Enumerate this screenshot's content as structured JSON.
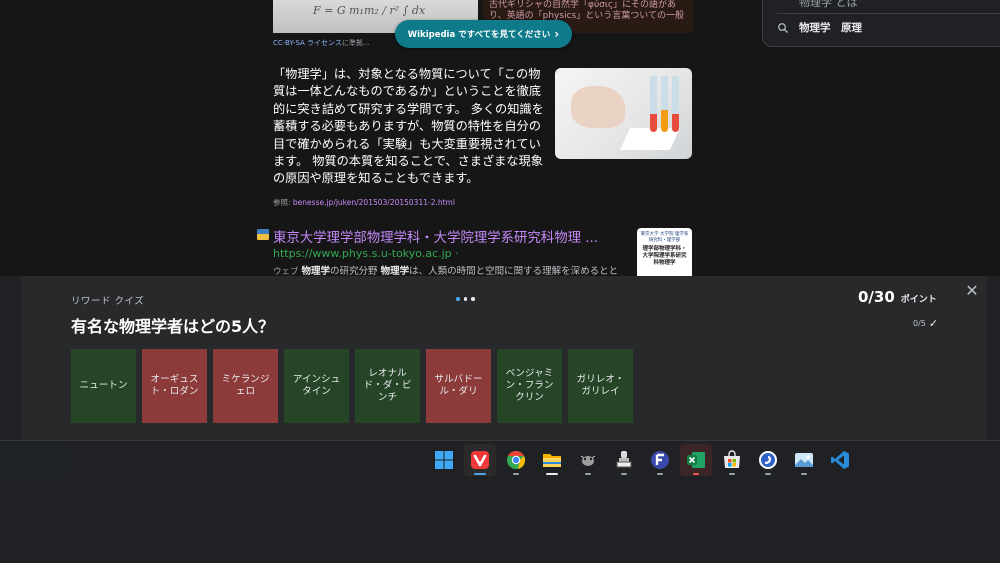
{
  "results": {
    "top_snippet": "古代ギリシャの自然学「φύσις」にその語があり、英語の「physics」という言葉ついての一般的な知識の",
    "license": {
      "link": "CC-BY-SA ライセンス",
      "rest": "に準拠..."
    },
    "wiki_button": "Wikipedia ですべてを見てください",
    "search_panel": {
      "cut_text": "物理学 とは",
      "query": "物理学　原理"
    },
    "paragraph": "「物理学」は、対象となる物質について「この物質は一体どんなものであるか」ということを徹底的に突き詰めて研究する学問です。 多くの知識を蓄積する必要もありますが、物質の特性を自分の目で確かめられる「実験」も大変重要視されています。 物質の本質を知ることで、さまざまな現象の原因や原理を知ることもできます。",
    "reference": {
      "label": "参照:",
      "link": "benesse.jp/juken/201503/20150311-2.html"
    },
    "result": {
      "title": "東京大学理学部物理学科・大学院理学系研究科物理 ...",
      "url": "https://www.phys.s.u-tokyo.ac.jp",
      "url_suffix": " ·",
      "tag": "ウェブ",
      "snippet_bold1": "物理学",
      "snippet_mid": "の研究分野 ",
      "snippet_bold2": "物理学",
      "snippet_rest": "は、人類の時間と空間に関する理解を深めるとと",
      "thumb_small": "東京大学 大学院 理学系研究科・理学部",
      "thumb_big": "理学部物理学科・大学院理学系研究科物理学"
    }
  },
  "quiz": {
    "label": "リワード クイズ",
    "points_value": "0/30",
    "points_unit": "ポイント",
    "question": "有名な物理学者はどの5人？",
    "progress": "0/5",
    "options": [
      {
        "label": "ニュートン",
        "state": "green"
      },
      {
        "label": "オーギュスト・ロダン",
        "state": "red"
      },
      {
        "label": "ミケランジェロ",
        "state": "red"
      },
      {
        "label": "アインシュタイン",
        "state": "green"
      },
      {
        "label": "レオナルド・ダ・ビンチ",
        "state": "green"
      },
      {
        "label": "サルバドール・ダリ",
        "state": "red"
      },
      {
        "label": "ベンジャミン・フランクリン",
        "state": "green"
      },
      {
        "label": "ガリレオ・ガリレイ",
        "state": "green"
      }
    ]
  },
  "taskbar": {
    "apps": [
      "windows-start",
      "vivaldi",
      "chrome",
      "file-explorer",
      "mouse-tool",
      "stamp-app",
      "ferdi",
      "excel",
      "microsoft-store",
      "simplenote",
      "photos",
      "vscode"
    ]
  },
  "colors": {
    "accent": "#0e7a8a",
    "correct": "#264426",
    "wrong": "#8c3a3a",
    "link": "#c58af9",
    "url": "#34a853"
  }
}
